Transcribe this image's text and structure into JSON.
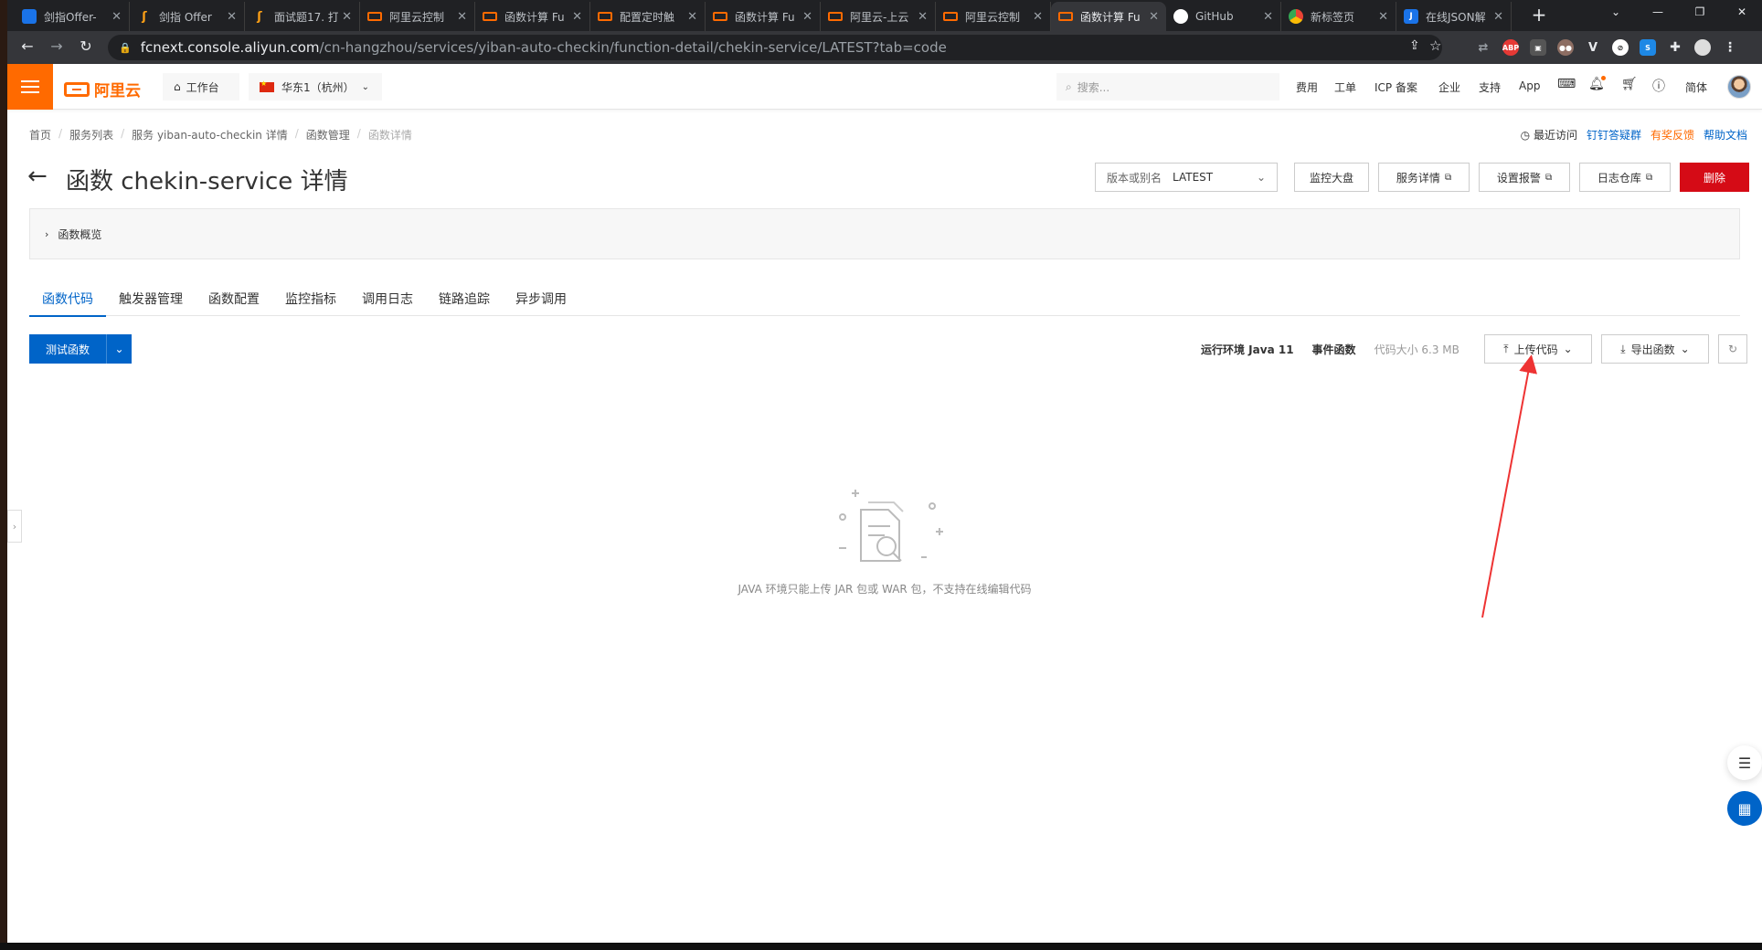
{
  "browser": {
    "tabs": [
      {
        "title": "剑指Offer-",
        "icon": "blue"
      },
      {
        "title": "剑指 Offer",
        "icon": "leet"
      },
      {
        "title": "面试题17. 打",
        "icon": "leet"
      },
      {
        "title": "阿里云控制",
        "icon": "ali"
      },
      {
        "title": "函数计算 Fu",
        "icon": "ali"
      },
      {
        "title": "配置定时触",
        "icon": "ali"
      },
      {
        "title": "函数计算 Fu",
        "icon": "ali"
      },
      {
        "title": "阿里云-上云",
        "icon": "ali"
      },
      {
        "title": "阿里云控制",
        "icon": "ali"
      },
      {
        "title": "函数计算 Fu",
        "icon": "ali",
        "active": true
      },
      {
        "title": "GitHub",
        "icon": "gh"
      },
      {
        "title": "新标签页",
        "icon": "chrome"
      },
      {
        "title": "在线JSON解",
        "icon": "json"
      }
    ],
    "url_host": "fcnext.console.aliyun.com",
    "url_path": "/cn-hangzhou/services/yiban-auto-checkin/function-detail/chekin-service/LATEST?tab=code"
  },
  "topbar": {
    "logo_text": "阿里云",
    "workbench": "工作台",
    "region": "华东1（杭州）",
    "search_placeholder": "搜索...",
    "links": [
      "费用",
      "工单",
      "ICP 备案",
      "企业",
      "支持",
      "App"
    ],
    "language": "简体"
  },
  "breadcrumb": [
    "首页",
    "服务列表",
    "服务 yiban-auto-checkin 详情",
    "函数管理",
    "函数详情"
  ],
  "help": {
    "recent": "最近访问",
    "dingtalk": "钉钉答疑群",
    "feedback": "有奖反馈",
    "docs": "帮助文档"
  },
  "page": {
    "title": "函数 chekin-service 详情",
    "version_label": "版本或别名",
    "version_value": "LATEST",
    "buttons": {
      "monitor": "监控大盘",
      "service_detail": "服务详情",
      "alarm": "设置报警",
      "log": "日志仓库",
      "delete": "删除"
    },
    "overview": "函数概览",
    "tabs": [
      "函数代码",
      "触发器管理",
      "函数配置",
      "监控指标",
      "调用日志",
      "链路追踪",
      "异步调用"
    ],
    "test_button": "测试函数",
    "runtime": "运行环境 Java 11",
    "event_fn": "事件函数",
    "code_size": "代码大小 6.3 MB",
    "upload": "上传代码",
    "export": "导出函数",
    "empty_text": "JAVA 环境只能上传 JAR 包或 WAR 包，不支持在线编辑代码"
  },
  "colors": {
    "brand": "#ff6a00",
    "primary": "#0064c8",
    "danger": "#d50b16",
    "annotation_arrow": "#ee3333"
  }
}
